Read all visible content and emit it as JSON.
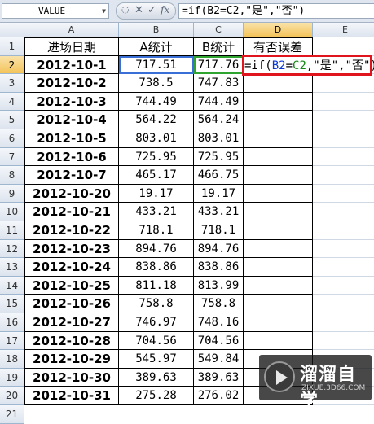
{
  "formula_bar": {
    "name_box": "VALUE",
    "cancel_icon": "✕",
    "enter_icon": "✓",
    "fx_label": "fx",
    "formula": "=if(B2=C2,\"是\",\"否\")"
  },
  "columns": [
    "A",
    "B",
    "C",
    "D",
    "E"
  ],
  "rows": [
    "1",
    "2",
    "3",
    "4",
    "5",
    "6",
    "7",
    "8",
    "9",
    "10",
    "11",
    "12",
    "13",
    "14",
    "15",
    "16",
    "17",
    "18",
    "19",
    "20",
    "21"
  ],
  "headers": {
    "a": "进场日期",
    "b": "A统计",
    "c": "B统计",
    "d": "有否误差"
  },
  "data": [
    {
      "date": "2012-10-1",
      "a": "717.51",
      "b": "717.76"
    },
    {
      "date": "2012-10-2",
      "a": "738.5",
      "b": "747.83"
    },
    {
      "date": "2012-10-3",
      "a": "744.49",
      "b": "744.49"
    },
    {
      "date": "2012-10-4",
      "a": "564.22",
      "b": "564.24"
    },
    {
      "date": "2012-10-5",
      "a": "803.01",
      "b": "803.01"
    },
    {
      "date": "2012-10-6",
      "a": "725.95",
      "b": "725.95"
    },
    {
      "date": "2012-10-7",
      "a": "465.17",
      "b": "466.75"
    },
    {
      "date": "2012-10-20",
      "a": "19.17",
      "b": "19.17"
    },
    {
      "date": "2012-10-21",
      "a": "433.21",
      "b": "433.21"
    },
    {
      "date": "2012-10-22",
      "a": "718.1",
      "b": "718.1"
    },
    {
      "date": "2012-10-23",
      "a": "894.76",
      "b": "894.76"
    },
    {
      "date": "2012-10-24",
      "a": "838.86",
      "b": "838.86"
    },
    {
      "date": "2012-10-25",
      "a": "811.18",
      "b": "813.99"
    },
    {
      "date": "2012-10-26",
      "a": "758.8",
      "b": "758.8"
    },
    {
      "date": "2012-10-27",
      "a": "746.97",
      "b": "748.16"
    },
    {
      "date": "2012-10-28",
      "a": "704.56",
      "b": "704.56"
    },
    {
      "date": "2012-10-29",
      "a": "545.97",
      "b": "549.84"
    },
    {
      "date": "2012-10-30",
      "a": "389.63",
      "b": "389.63"
    },
    {
      "date": "2012-10-31",
      "a": "275.28",
      "b": "276.02"
    }
  ],
  "edit_cell": {
    "prefix": "=if(",
    "ref_b": "B2",
    "eq": "=",
    "ref_c": "C2",
    "suffix": ",\"是\",\"否\")"
  },
  "watermark": {
    "title": "溜溜自学",
    "url": "ZIXUE.3D66.COM",
    "icon": "play-icon"
  },
  "colors": {
    "highlight_box": "#e0141c",
    "ref_b": "#0b36d8",
    "ref_c": "#138a13",
    "selected_header": "#f4c35b"
  }
}
